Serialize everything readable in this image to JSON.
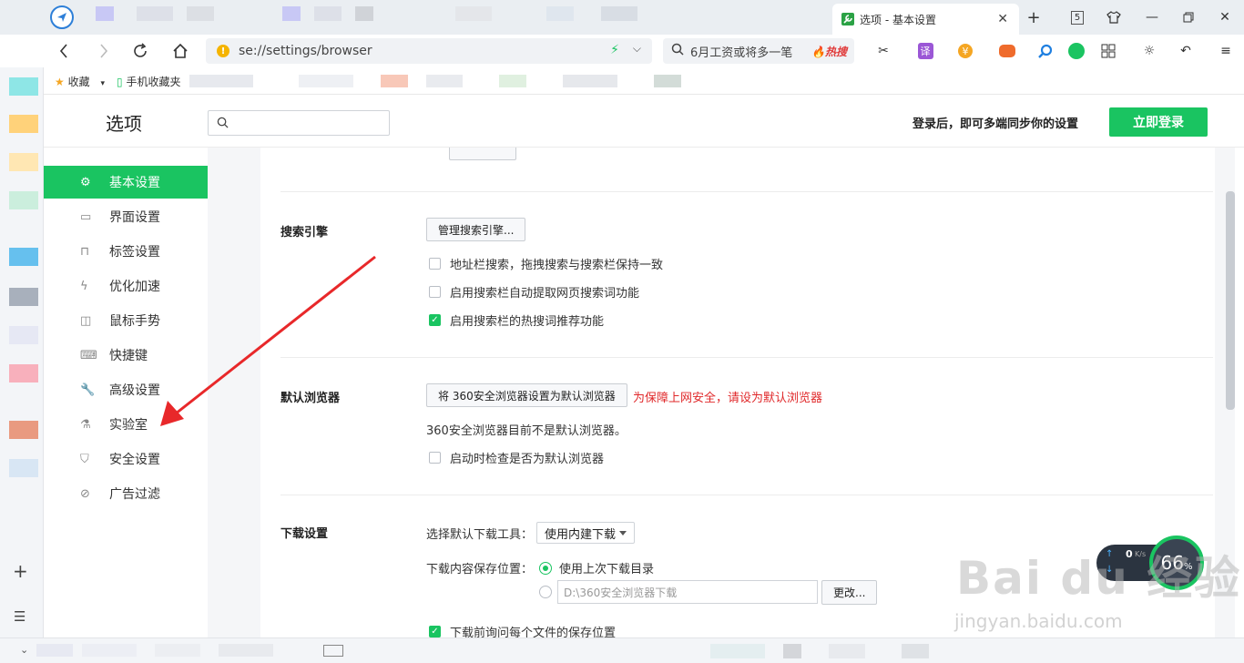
{
  "browser": {
    "active_tab_title": "选项 - 基本设置",
    "tab_count": "5",
    "address": "se://settings/browser",
    "search_box_text": "6月工资或将多一笔",
    "search_hot_label": "热搜",
    "translate_label": "译"
  },
  "bookmarks": {
    "favorites_label": "收藏",
    "mobile_label": "手机收藏夹"
  },
  "header": {
    "title": "选项",
    "search_placeholder": "",
    "sync_text": "登录后，即可多端同步你的设置",
    "login_button": "立即登录"
  },
  "menu": {
    "items": [
      {
        "label": "基本设置",
        "icon": "gear-icon"
      },
      {
        "label": "界面设置",
        "icon": "window-icon"
      },
      {
        "label": "标签设置",
        "icon": "tab-icon"
      },
      {
        "label": "优化加速",
        "icon": "bolt-icon"
      },
      {
        "label": "鼠标手势",
        "icon": "mouse-icon"
      },
      {
        "label": "快捷键",
        "icon": "keyboard-icon"
      },
      {
        "label": "高级设置",
        "icon": "wrench-icon"
      },
      {
        "label": "实验室",
        "icon": "flask-icon"
      },
      {
        "label": "安全设置",
        "icon": "shield-icon"
      },
      {
        "label": "广告过滤",
        "icon": "block-icon"
      }
    ]
  },
  "sections": {
    "search_engine": {
      "title": "搜索引擎",
      "manage_button": "管理搜索引擎...",
      "options": [
        {
          "label": "地址栏搜索，拖拽搜索与搜索栏保持一致",
          "checked": false
        },
        {
          "label": "启用搜索栏自动提取网页搜索词功能",
          "checked": false
        },
        {
          "label": "启用搜索栏的热搜词推荐功能",
          "checked": true
        }
      ]
    },
    "default_browser": {
      "title": "默认浏览器",
      "set_default_button": "将 360安全浏览器设置为默认浏览器",
      "warning": "为保障上网安全，请设为默认浏览器",
      "status": "360安全浏览器目前不是默认浏览器。",
      "check_on_start": {
        "label": "启动时检查是否为默认浏览器",
        "checked": false
      }
    },
    "download": {
      "title": "下载设置",
      "tool_label": "选择默认下载工具：",
      "tool_value": "使用内建下载",
      "location_label": "下载内容保存位置：",
      "radio_last": "使用上次下载目录",
      "path_value": "D:\\360安全浏览器下载",
      "change_button": "更改...",
      "ask_each": {
        "label": "下载前询问每个文件的保存位置",
        "checked": true
      }
    }
  },
  "speed_widget": {
    "rate": "0",
    "unit": "K/s",
    "percent": "66",
    "percent_sign": "%"
  },
  "watermark": {
    "text": "Bai du 经验",
    "url": "jingyan.baidu.com"
  },
  "colors": {
    "accent": "#1ac461",
    "warning": "#e0282a",
    "arrow": "#e8282a"
  }
}
